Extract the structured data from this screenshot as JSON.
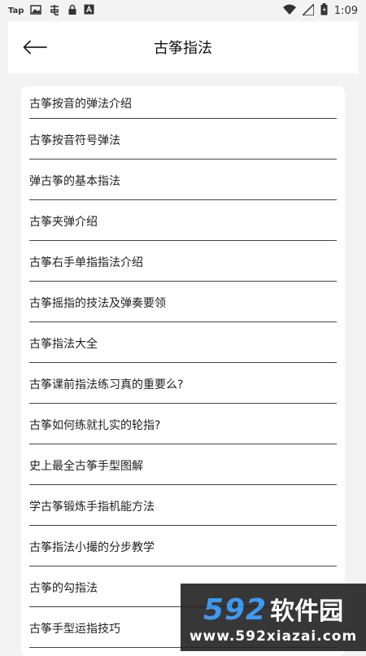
{
  "status_bar": {
    "carrier_text": "Tap",
    "time": "1:09",
    "icons": [
      "image-icon",
      "app-icon",
      "lock-icon",
      "text-icon",
      "wifi-icon",
      "signal-icon",
      "battery-icon"
    ]
  },
  "header": {
    "title": "古筝指法",
    "back_icon": "arrow-left-icon"
  },
  "list": {
    "items": [
      "古筝按音的弹法介绍",
      "古筝按音符号弹法",
      "弹古筝的基本指法",
      "古筝夹弹介绍",
      "古筝右手单指指法介绍",
      "古筝摇指的技法及弹奏要领",
      "古筝指法大全",
      "古筝课前指法练习真的重要么?",
      "古筝如何练就扎实的轮指?",
      "史上最全古筝手型图解",
      "学古筝锻炼手指机能方法",
      "古筝指法小撮的分步教学",
      "古筝的勾指法",
      "古筝手型运指技巧"
    ]
  },
  "watermark": {
    "number": "592",
    "brand": "软件园",
    "url": "www.592xiazai.com"
  },
  "colors": {
    "background": "#f3f3f3",
    "card": "#ffffff",
    "divider": "#444444",
    "watermark_blue": "#2b8ef0"
  }
}
